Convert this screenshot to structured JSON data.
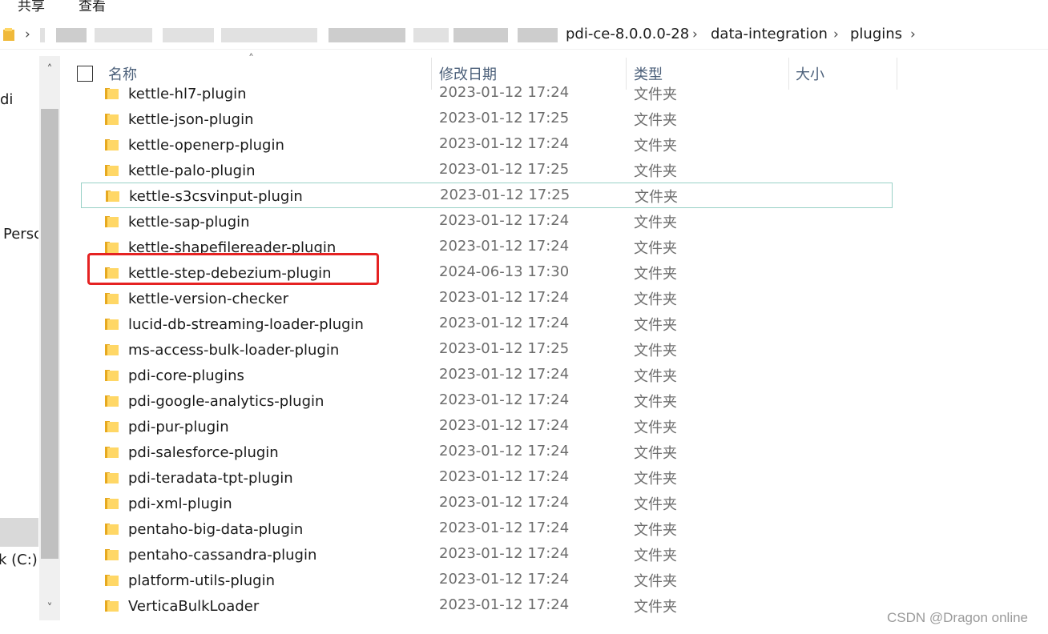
{
  "ribbon": {
    "tabs": [
      "共享",
      "查看"
    ]
  },
  "address_bar": {
    "breadcrumbs": [
      "pdi-ce-8.0.0.0-28",
      "data-integration",
      "plugins"
    ],
    "chevron": "›"
  },
  "navigation_pane": {
    "items": [
      "di",
      "Persc",
      "k (C:)"
    ]
  },
  "scrollbar": {
    "up": "˄",
    "down": "˅"
  },
  "columns": {
    "name": "名称",
    "modified": "修改日期",
    "type": "类型",
    "size": "大小",
    "sort_indicator": "˄"
  },
  "files": [
    {
      "name": "kettle-hl7-plugin",
      "modified": "2023-01-12 17:24",
      "type": "文件夹"
    },
    {
      "name": "kettle-json-plugin",
      "modified": "2023-01-12 17:25",
      "type": "文件夹"
    },
    {
      "name": "kettle-openerp-plugin",
      "modified": "2023-01-12 17:24",
      "type": "文件夹"
    },
    {
      "name": "kettle-palo-plugin",
      "modified": "2023-01-12 17:25",
      "type": "文件夹"
    },
    {
      "name": "kettle-s3csvinput-plugin",
      "modified": "2023-01-12 17:25",
      "type": "文件夹"
    },
    {
      "name": "kettle-sap-plugin",
      "modified": "2023-01-12 17:24",
      "type": "文件夹"
    },
    {
      "name": "kettle-shapefilereader-plugin",
      "modified": "2023-01-12 17:24",
      "type": "文件夹"
    },
    {
      "name": "kettle-step-debezium-plugin",
      "modified": "2024-06-13 17:30",
      "type": "文件夹"
    },
    {
      "name": "kettle-version-checker",
      "modified": "2023-01-12 17:24",
      "type": "文件夹"
    },
    {
      "name": "lucid-db-streaming-loader-plugin",
      "modified": "2023-01-12 17:24",
      "type": "文件夹"
    },
    {
      "name": "ms-access-bulk-loader-plugin",
      "modified": "2023-01-12 17:25",
      "type": "文件夹"
    },
    {
      "name": "pdi-core-plugins",
      "modified": "2023-01-12 17:24",
      "type": "文件夹"
    },
    {
      "name": "pdi-google-analytics-plugin",
      "modified": "2023-01-12 17:24",
      "type": "文件夹"
    },
    {
      "name": "pdi-pur-plugin",
      "modified": "2023-01-12 17:24",
      "type": "文件夹"
    },
    {
      "name": "pdi-salesforce-plugin",
      "modified": "2023-01-12 17:24",
      "type": "文件夹"
    },
    {
      "name": "pdi-teradata-tpt-plugin",
      "modified": "2023-01-12 17:24",
      "type": "文件夹"
    },
    {
      "name": "pdi-xml-plugin",
      "modified": "2023-01-12 17:24",
      "type": "文件夹"
    },
    {
      "name": "pentaho-big-data-plugin",
      "modified": "2023-01-12 17:24",
      "type": "文件夹"
    },
    {
      "name": "pentaho-cassandra-plugin",
      "modified": "2023-01-12 17:24",
      "type": "文件夹"
    },
    {
      "name": "platform-utils-plugin",
      "modified": "2023-01-12 17:24",
      "type": "文件夹"
    },
    {
      "name": "VerticaBulkLoader",
      "modified": "2023-01-12 17:24",
      "type": "文件夹"
    }
  ],
  "watermark": "CSDN @Dragon online",
  "colors": {
    "folder": "#ffd766",
    "highlight": "#e52222",
    "focus_border": "#99d1c6",
    "header_text": "#4c607a"
  }
}
